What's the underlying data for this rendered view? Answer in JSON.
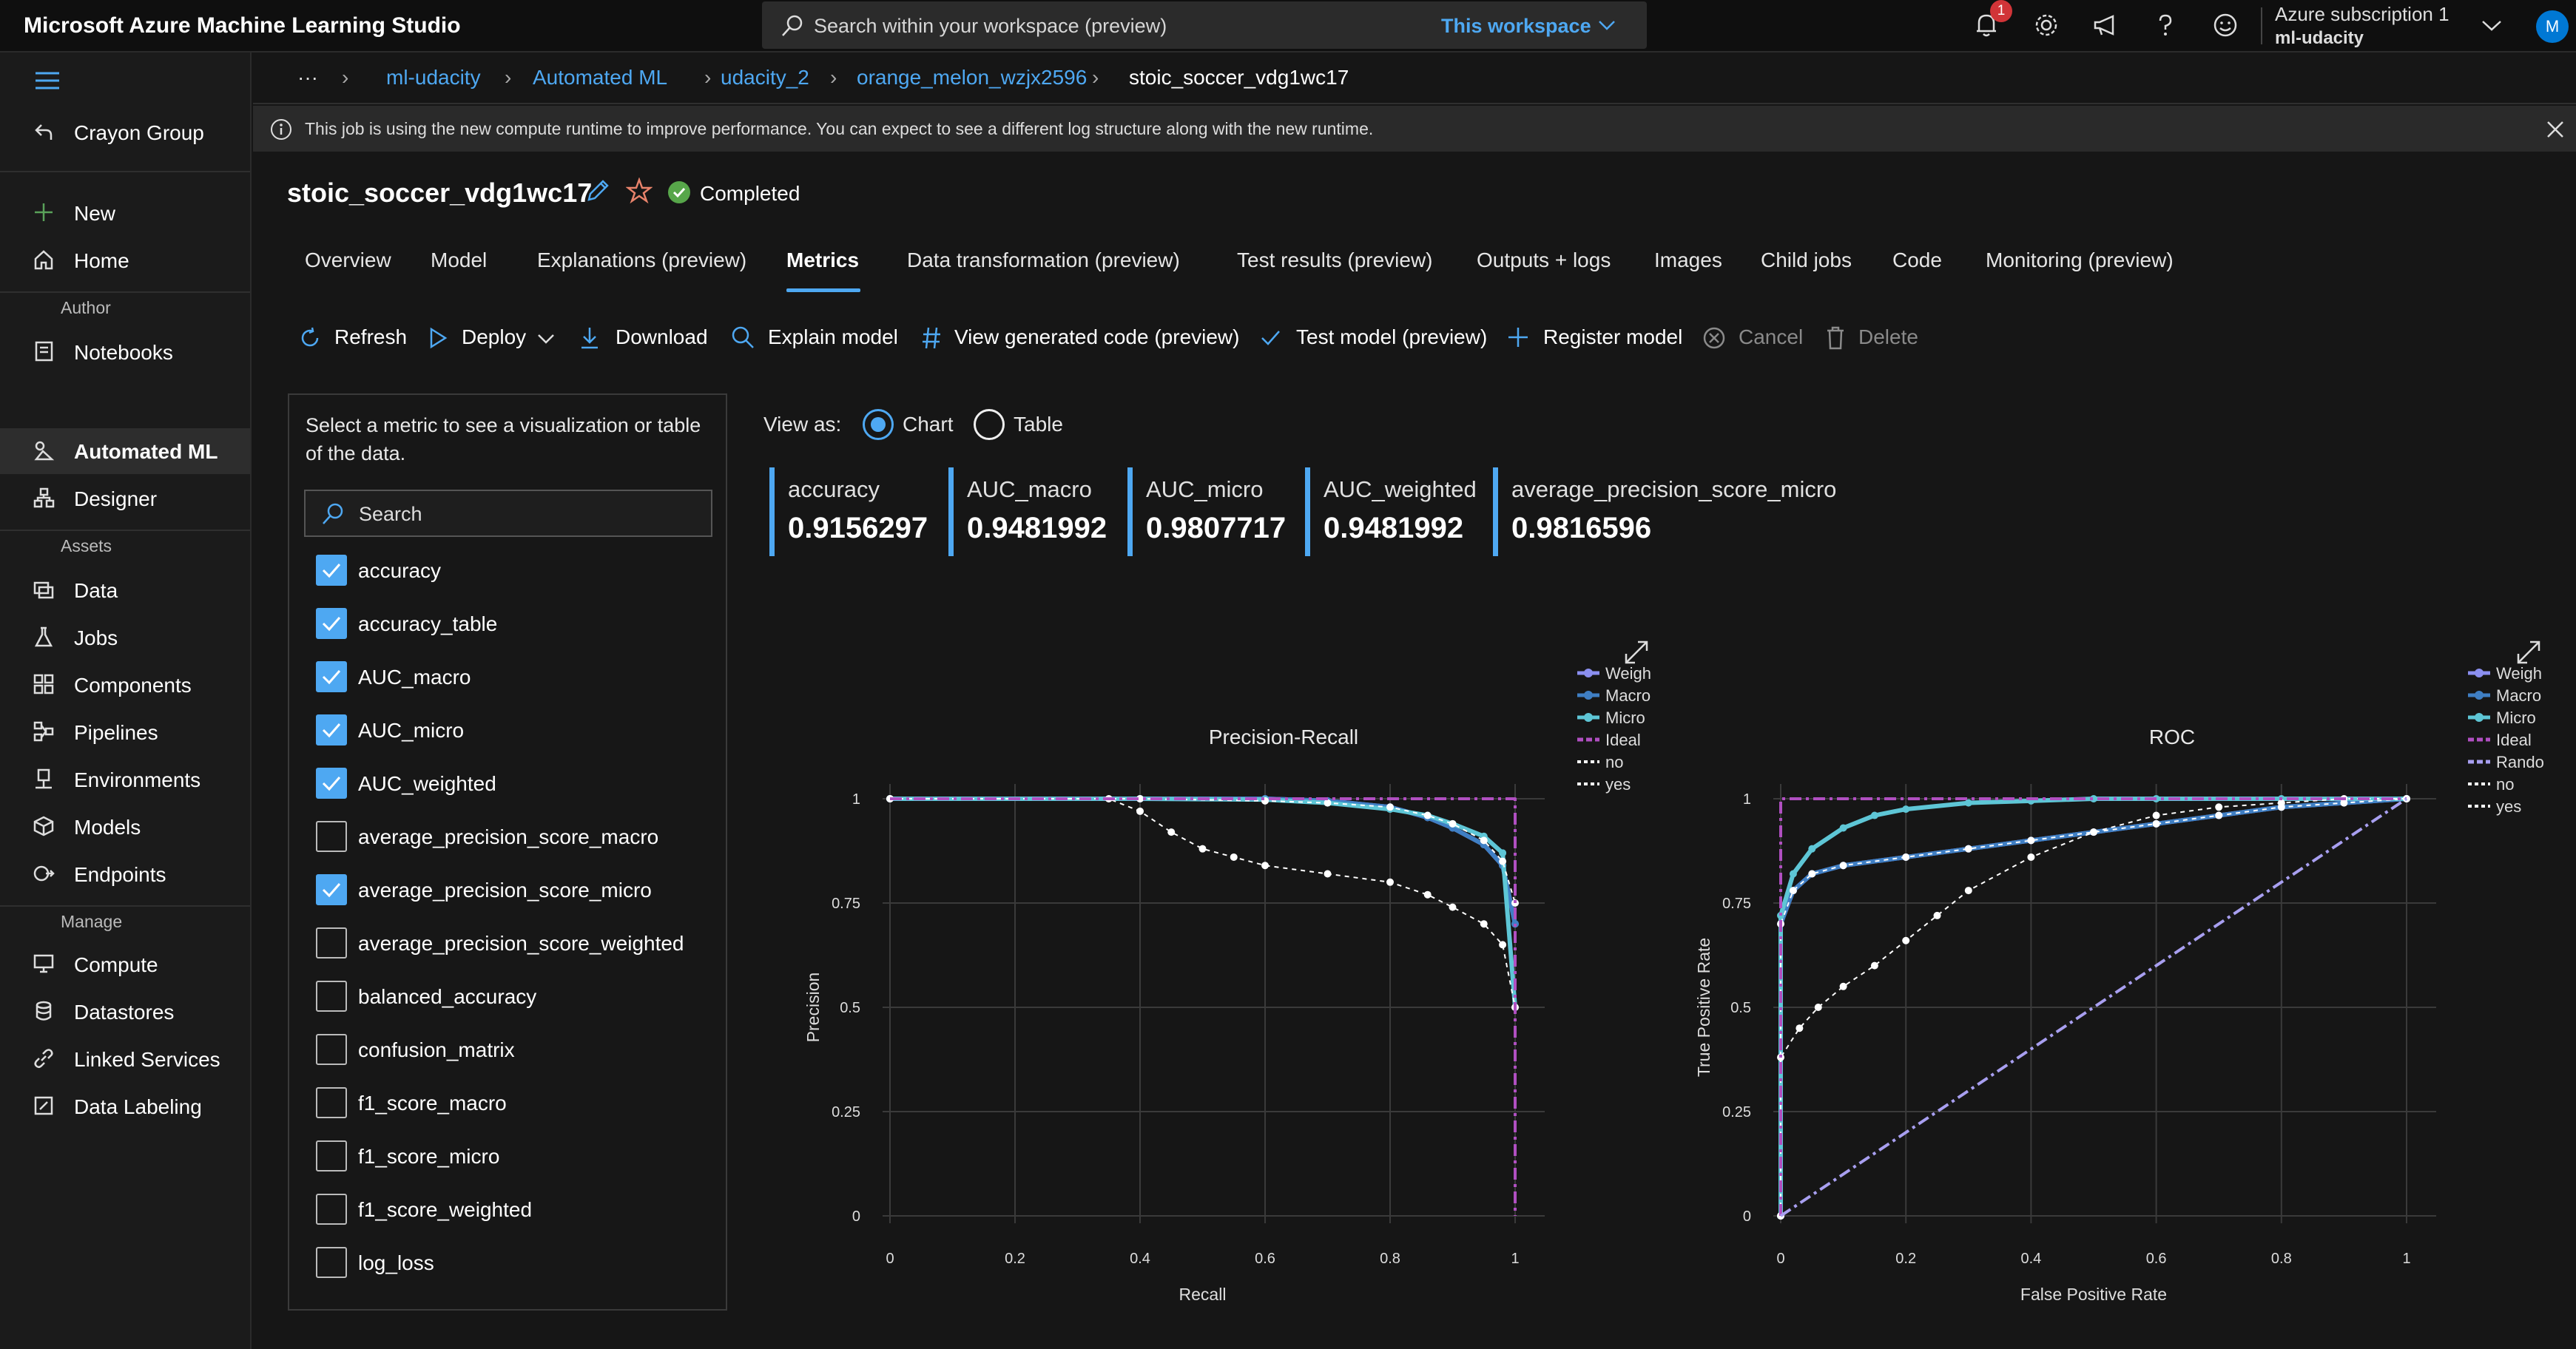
{
  "app": {
    "name": "Microsoft Azure Machine Learning Studio"
  },
  "search": {
    "placeholder": "Search within your workspace (preview)",
    "scope": "This workspace"
  },
  "header": {
    "notification_count": "1",
    "subscription": "Azure subscription 1",
    "workspace": "ml-udacity",
    "avatar": "M"
  },
  "sidebar": {
    "org": "Crayon Group",
    "items": [
      {
        "label": "New",
        "icon": "plus-icon"
      },
      {
        "label": "Home",
        "icon": "home-icon"
      },
      {
        "label": "Notebooks",
        "icon": "notebook-icon"
      },
      {
        "label": "Automated ML",
        "icon": "automl-icon"
      },
      {
        "label": "Designer",
        "icon": "designer-icon"
      },
      {
        "label": "Data",
        "icon": "data-icon"
      },
      {
        "label": "Jobs",
        "icon": "flask-icon"
      },
      {
        "label": "Components",
        "icon": "components-icon"
      },
      {
        "label": "Pipelines",
        "icon": "pipelines-icon"
      },
      {
        "label": "Environments",
        "icon": "environments-icon"
      },
      {
        "label": "Models",
        "icon": "cube-icon"
      },
      {
        "label": "Endpoints",
        "icon": "endpoints-icon"
      },
      {
        "label": "Compute",
        "icon": "compute-icon"
      },
      {
        "label": "Datastores",
        "icon": "database-icon"
      },
      {
        "label": "Linked Services",
        "icon": "link-icon"
      },
      {
        "label": "Data Labeling",
        "icon": "labeling-icon"
      }
    ],
    "groups": {
      "author": "Author",
      "assets": "Assets",
      "manage": "Manage"
    }
  },
  "breadcrumb": {
    "more": "···",
    "items": [
      "ml-udacity",
      "Automated ML",
      "udacity_2",
      "orange_melon_wzjx2596"
    ],
    "current": "stoic_soccer_vdg1wc17"
  },
  "banner": {
    "text": "This job is using the new compute runtime to improve performance. You can expect to see a different log structure along with the new runtime."
  },
  "job": {
    "title": "stoic_soccer_vdg1wc17",
    "status": "Completed"
  },
  "tabs": [
    "Overview",
    "Model",
    "Explanations (preview)",
    "Metrics",
    "Data transformation (preview)",
    "Test results (preview)",
    "Outputs + logs",
    "Images",
    "Child jobs",
    "Code",
    "Monitoring (preview)"
  ],
  "toolbar": {
    "refresh": "Refresh",
    "deploy": "Deploy",
    "download": "Download",
    "explain": "Explain model",
    "view_code": "View generated code (preview)",
    "test_model": "Test model (preview)",
    "register": "Register model",
    "cancel": "Cancel",
    "delete": "Delete"
  },
  "metrics_panel": {
    "instructions": "Select a metric to see a visualization or table of the data.",
    "search_placeholder": "Search",
    "items": [
      {
        "label": "accuracy",
        "checked": true
      },
      {
        "label": "accuracy_table",
        "checked": true
      },
      {
        "label": "AUC_macro",
        "checked": true
      },
      {
        "label": "AUC_micro",
        "checked": true
      },
      {
        "label": "AUC_weighted",
        "checked": true
      },
      {
        "label": "average_precision_score_macro",
        "checked": false
      },
      {
        "label": "average_precision_score_micro",
        "checked": true
      },
      {
        "label": "average_precision_score_weighted",
        "checked": false
      },
      {
        "label": "balanced_accuracy",
        "checked": false
      },
      {
        "label": "confusion_matrix",
        "checked": false
      },
      {
        "label": "f1_score_macro",
        "checked": false
      },
      {
        "label": "f1_score_micro",
        "checked": false
      },
      {
        "label": "f1_score_weighted",
        "checked": false
      },
      {
        "label": "log_loss",
        "checked": false
      }
    ]
  },
  "view_as": {
    "label": "View as:",
    "chart": "Chart",
    "table": "Table",
    "selected": "Chart"
  },
  "metric_cards": [
    {
      "name": "accuracy",
      "value": "0.9156297"
    },
    {
      "name": "AUC_macro",
      "value": "0.9481992"
    },
    {
      "name": "AUC_micro",
      "value": "0.9807717"
    },
    {
      "name": "AUC_weighted",
      "value": "0.9481992"
    },
    {
      "name": "average_precision_score_micro",
      "value": "0.9816596"
    }
  ],
  "colors": {
    "accent": "#4ea8f2",
    "weighted": "#8b8ff0",
    "macro": "#3f7fc4",
    "micro": "#5ec6d6",
    "ideal": "#b04fc1",
    "random": "#a89ff0"
  },
  "chart_data": [
    {
      "type": "line",
      "title": "Precision-Recall",
      "xlabel": "Recall",
      "ylabel": "Precision",
      "xlim": [
        0,
        1
      ],
      "ylim": [
        0,
        1
      ],
      "xticks": [
        "0",
        "0.2",
        "0.4",
        "0.6",
        "0.8",
        "1"
      ],
      "yticks": [
        "0",
        "0.25",
        "0.5",
        "0.75",
        "1"
      ],
      "legend": [
        "Weigh",
        "Macro",
        "Micro",
        "Ideal",
        "no",
        "yes"
      ],
      "series": [
        {
          "name": "Weigh",
          "x": [
            0,
            0.4,
            0.6,
            0.7,
            0.8,
            0.86,
            0.9,
            0.95,
            0.98,
            1
          ],
          "y": [
            1,
            1,
            1,
            0.995,
            0.98,
            0.955,
            0.93,
            0.89,
            0.84,
            0.7
          ]
        },
        {
          "name": "Macro",
          "x": [
            0,
            0.4,
            0.6,
            0.7,
            0.8,
            0.86,
            0.9,
            0.95,
            0.98,
            1
          ],
          "y": [
            1,
            1,
            1,
            0.995,
            0.98,
            0.955,
            0.93,
            0.89,
            0.84,
            0.7
          ]
        },
        {
          "name": "Micro",
          "x": [
            0,
            0.4,
            0.6,
            0.7,
            0.8,
            0.86,
            0.9,
            0.95,
            0.98,
            1
          ],
          "y": [
            1,
            1,
            0.998,
            0.99,
            0.975,
            0.96,
            0.94,
            0.91,
            0.87,
            0.5
          ]
        },
        {
          "name": "no",
          "x": [
            0,
            0.4,
            0.6,
            0.7,
            0.8,
            0.86,
            0.9,
            0.95,
            0.98,
            1
          ],
          "y": [
            1,
            1,
            0.995,
            0.99,
            0.98,
            0.96,
            0.94,
            0.9,
            0.85,
            0.75
          ]
        },
        {
          "name": "yes",
          "x": [
            0,
            0.35,
            0.4,
            0.45,
            0.5,
            0.55,
            0.6,
            0.7,
            0.8,
            0.86,
            0.9,
            0.95,
            0.98,
            1
          ],
          "y": [
            1,
            1,
            0.97,
            0.92,
            0.88,
            0.86,
            0.84,
            0.82,
            0.8,
            0.77,
            0.74,
            0.7,
            0.65,
            0.5
          ]
        },
        {
          "name": "Ideal",
          "x": [
            0,
            1,
            1
          ],
          "y": [
            1,
            1,
            0
          ]
        }
      ]
    },
    {
      "type": "line",
      "title": "ROC",
      "xlabel": "False Positive Rate",
      "ylabel": "True Positive Rate",
      "xlim": [
        0,
        1
      ],
      "ylim": [
        0,
        1
      ],
      "xticks": [
        "0",
        "0.2",
        "0.4",
        "0.6",
        "0.8",
        "1"
      ],
      "yticks": [
        "0",
        "0.25",
        "0.5",
        "0.75",
        "1"
      ],
      "legend": [
        "Weigh",
        "Macro",
        "Micro",
        "Ideal",
        "Rando",
        "no",
        "yes"
      ],
      "series": [
        {
          "name": "Weigh",
          "x": [
            0,
            0,
            0.02,
            0.05,
            0.1,
            0.2,
            0.3,
            0.4,
            0.5,
            0.6,
            0.7,
            0.8,
            0.9,
            1
          ],
          "y": [
            0,
            0.7,
            0.78,
            0.82,
            0.84,
            0.86,
            0.88,
            0.9,
            0.92,
            0.94,
            0.96,
            0.98,
            0.99,
            1
          ]
        },
        {
          "name": "Macro",
          "x": [
            0,
            0,
            0.02,
            0.05,
            0.1,
            0.2,
            0.3,
            0.4,
            0.5,
            0.6,
            0.7,
            0.8,
            0.9,
            1
          ],
          "y": [
            0,
            0.7,
            0.78,
            0.82,
            0.84,
            0.86,
            0.88,
            0.9,
            0.92,
            0.94,
            0.96,
            0.98,
            0.99,
            1
          ]
        },
        {
          "name": "Micro",
          "x": [
            0,
            0,
            0.02,
            0.05,
            0.1,
            0.15,
            0.2,
            0.3,
            0.4,
            0.5,
            0.6,
            0.8,
            1
          ],
          "y": [
            0,
            0.72,
            0.82,
            0.88,
            0.93,
            0.96,
            0.975,
            0.99,
            0.995,
            1,
            1,
            1,
            1
          ]
        },
        {
          "name": "no",
          "x": [
            0,
            0,
            0.02,
            0.05,
            0.1,
            0.2,
            0.3,
            0.4,
            0.5,
            0.6,
            0.7,
            0.8,
            0.9,
            1
          ],
          "y": [
            0,
            0.7,
            0.78,
            0.82,
            0.84,
            0.86,
            0.88,
            0.9,
            0.92,
            0.94,
            0.96,
            0.98,
            0.99,
            1
          ]
        },
        {
          "name": "yes",
          "x": [
            0,
            0,
            0.03,
            0.06,
            0.1,
            0.15,
            0.2,
            0.25,
            0.3,
            0.4,
            0.5,
            0.6,
            0.7,
            0.8,
            0.9,
            1
          ],
          "y": [
            0,
            0.38,
            0.45,
            0.5,
            0.55,
            0.6,
            0.66,
            0.72,
            0.78,
            0.86,
            0.92,
            0.96,
            0.98,
            0.99,
            1,
            1
          ]
        },
        {
          "name": "Ideal",
          "x": [
            0,
            0,
            1
          ],
          "y": [
            0,
            1,
            1
          ]
        },
        {
          "name": "Rando",
          "x": [
            0,
            1
          ],
          "y": [
            0,
            1
          ]
        }
      ]
    }
  ]
}
